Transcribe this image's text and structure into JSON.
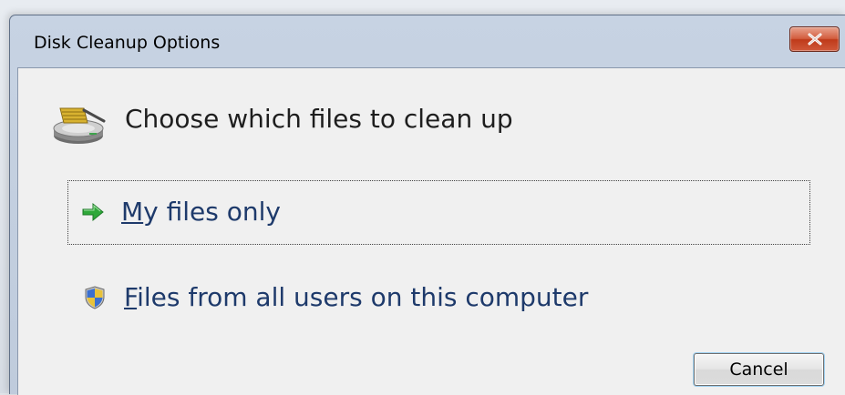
{
  "window": {
    "title": "Disk Cleanup Options"
  },
  "dialog": {
    "heading": "Choose which files to clean up",
    "heading_icon": "disk-cleanup-icon",
    "options": [
      {
        "label": "My files only",
        "icon": "green-arrow-icon",
        "selected": true
      },
      {
        "label": "Files from all users on this computer",
        "icon": "uac-shield-icon",
        "selected": false
      }
    ],
    "cancel_label": "Cancel"
  },
  "colors": {
    "link_text": "#1e3a6b",
    "close_button": "#c94a2b",
    "window_frame": "#c3cfe0",
    "client_bg": "#f0f0f0"
  }
}
